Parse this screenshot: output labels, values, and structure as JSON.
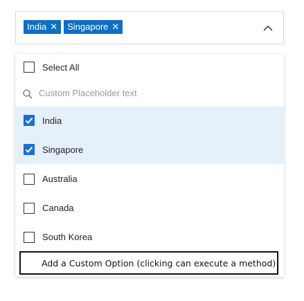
{
  "select": {
    "chips": [
      {
        "label": "India",
        "remove": "✕"
      },
      {
        "label": "Singapore",
        "remove": "✕"
      }
    ]
  },
  "dropdown": {
    "select_all_label": "Select All",
    "search_placeholder": "Custom Placeholder text",
    "search_value": "",
    "options": [
      {
        "label": "India",
        "checked": true
      },
      {
        "label": "Singapore",
        "checked": true
      },
      {
        "label": "Australia",
        "checked": false
      },
      {
        "label": "Canada",
        "checked": false
      },
      {
        "label": "South Korea",
        "checked": false
      }
    ],
    "custom_option_label": "Add a Custom Option (clicking can execute a method)"
  },
  "colors": {
    "chip_bg": "#0e6fc4",
    "checkbox_checked": "#1e6fd1",
    "selected_row_bg": "#e6f0fb"
  },
  "icons": {
    "chip_remove": "close-icon",
    "caret": "chevron-up-icon",
    "search": "search-icon",
    "checkbox_checked": "check-icon"
  }
}
